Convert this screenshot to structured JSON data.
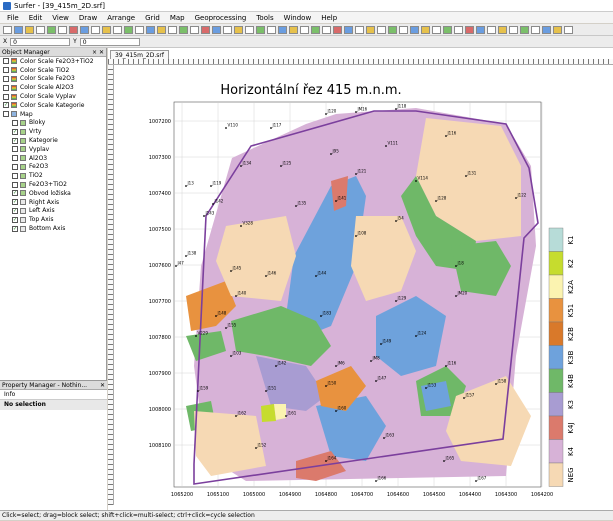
{
  "window": {
    "title": "Surfer - [39_415m_2D.srf]"
  },
  "menu": [
    "File",
    "Edit",
    "View",
    "Draw",
    "Arrange",
    "Grid",
    "Map",
    "Geoprocessing",
    "Tools",
    "Window",
    "Help"
  ],
  "coords": {
    "x_label": "X",
    "x_value": "0",
    "y_label": "Y",
    "y_value": "0"
  },
  "object_manager": {
    "title": "Object Manager",
    "items": [
      {
        "label": "Color Scale Fe2O3+TiO2",
        "checked": false,
        "icon": "colorscale-icon",
        "indent": 0
      },
      {
        "label": "Color Scale TiO2",
        "checked": false,
        "icon": "colorscale-icon",
        "indent": 0
      },
      {
        "label": "Color Scale Fe2O3",
        "checked": false,
        "icon": "colorscale-icon",
        "indent": 0
      },
      {
        "label": "Color Scale Al2O3",
        "checked": false,
        "icon": "colorscale-icon",
        "indent": 0
      },
      {
        "label": "Color Scale Vyplav",
        "checked": false,
        "icon": "colorscale-icon",
        "indent": 0
      },
      {
        "label": "Color Scale Kategorie",
        "checked": true,
        "icon": "colorscale-icon",
        "indent": 0
      },
      {
        "label": "Map",
        "checked": false,
        "icon": "map-icon",
        "indent": 0
      },
      {
        "label": "Bloky",
        "checked": false,
        "icon": "layer-icon",
        "indent": 1
      },
      {
        "label": "Vrty",
        "checked": true,
        "icon": "layer-icon",
        "indent": 1
      },
      {
        "label": "Kategorie",
        "checked": true,
        "icon": "layer-icon",
        "indent": 1
      },
      {
        "label": "Vyplav",
        "checked": false,
        "icon": "layer-icon",
        "indent": 1
      },
      {
        "label": "Al2O3",
        "checked": false,
        "icon": "layer-icon",
        "indent": 1
      },
      {
        "label": "Fe2O3",
        "checked": false,
        "icon": "layer-icon",
        "indent": 1
      },
      {
        "label": "TiO2",
        "checked": false,
        "icon": "layer-icon",
        "indent": 1
      },
      {
        "label": "Fe2O3+TiO2",
        "checked": false,
        "icon": "layer-icon",
        "indent": 1
      },
      {
        "label": "Obvod ložiska",
        "checked": true,
        "icon": "layer-icon",
        "indent": 1
      },
      {
        "label": "Right Axis",
        "checked": true,
        "icon": "axis-icon",
        "indent": 1
      },
      {
        "label": "Left Axis",
        "checked": true,
        "icon": "axis-icon",
        "indent": 1
      },
      {
        "label": "Top Axis",
        "checked": true,
        "icon": "axis-icon",
        "indent": 1
      },
      {
        "label": "Bottom Axis",
        "checked": true,
        "icon": "axis-icon",
        "indent": 1
      }
    ]
  },
  "property_manager": {
    "title": "Property Manager - Nothin...",
    "tab": "Info",
    "message": "No selection"
  },
  "document": {
    "tab": "39_415m_2D.srf"
  },
  "map": {
    "title": "Horizontální řez 415 m.n.m.",
    "x_ticks": [
      "1065200",
      "1065100",
      "1065000",
      "1064900",
      "1064800",
      "1064700",
      "1064600",
      "1064500",
      "1064400",
      "1064300",
      "1064200"
    ],
    "y_ticks": [
      "1007200",
      "1007300",
      "1007400",
      "1007500",
      "1007600",
      "1007700",
      "1007800",
      "1007900",
      "1008000",
      "1008100"
    ],
    "legend": [
      {
        "label": "K1",
        "color": "#b7dcd8"
      },
      {
        "label": "K2",
        "color": "#c6dc2e"
      },
      {
        "label": "K2A",
        "color": "#fbf3b0"
      },
      {
        "label": "K51",
        "color": "#e8923f"
      },
      {
        "label": "K2B",
        "color": "#d9792a"
      },
      {
        "label": "K3B",
        "color": "#6ea2dc"
      },
      {
        "label": "K4B",
        "color": "#6fb868"
      },
      {
        "label": "K3",
        "color": "#a89cd2"
      },
      {
        "label": "K4J",
        "color": "#db7a6c"
      },
      {
        "label": "K4",
        "color": "#d7b2d7"
      },
      {
        "label": "NEG",
        "color": "#f6d9b4"
      }
    ],
    "boreholes": [
      "J120",
      "JM16",
      "J118",
      "V110",
      "J117",
      "V111",
      "J116",
      "J95",
      "J125",
      "J134",
      "J121",
      "V114",
      "J131",
      "J119",
      "J142",
      "J141",
      "J135",
      "J13",
      "J122",
      "J128",
      "J54",
      "J143",
      "V328",
      "J108",
      "J18",
      "J138",
      "J145",
      "J47",
      "J144",
      "J146",
      "J140",
      "J129",
      "J148",
      "JM20",
      "J183",
      "J155",
      "J149",
      "J124",
      "JM8",
      "J116",
      "J142",
      "JM6",
      "J147",
      "V229",
      "J103",
      "J150",
      "J151",
      "J153",
      "J157",
      "J158",
      "J159",
      "J162",
      "J160",
      "J161",
      "J152",
      "J163",
      "J164",
      "J165",
      "J166",
      "J167"
    ],
    "boundary_color": "#7b3f9d"
  },
  "status": "Click=select; drag=block select; shift+click=multi-select; ctrl+click=cycle selection"
}
